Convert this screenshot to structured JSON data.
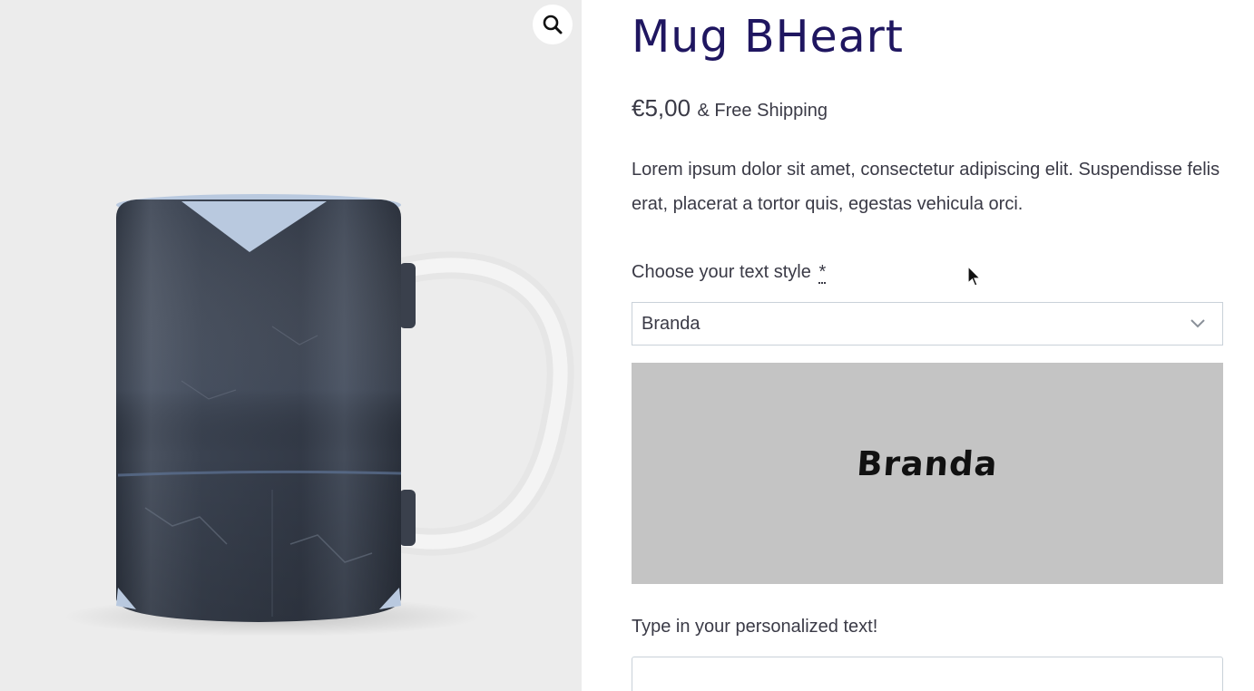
{
  "product": {
    "title": "Mug BHeart",
    "price": "€5,00",
    "shipping": "& Free Shipping",
    "description": "Lorem ipsum dolor sit amet, consectetur adipiscing elit. Suspendisse felis erat, placerat a tortor quis, egestas vehicula orci."
  },
  "gallery": {
    "zoom_icon": "magnifier-icon",
    "image_alt": "mug-image"
  },
  "text_style": {
    "label": "Choose your text style",
    "required_mark": "*",
    "selected": "Branda",
    "preview_text": "Branda"
  },
  "personalized_text": {
    "label": "Type in your personalized text!",
    "value": "",
    "placeholder": ""
  },
  "colors": {
    "title": "#1f1660",
    "preview_bg": "#c4c4c4",
    "gallery_bg": "#ececec"
  }
}
